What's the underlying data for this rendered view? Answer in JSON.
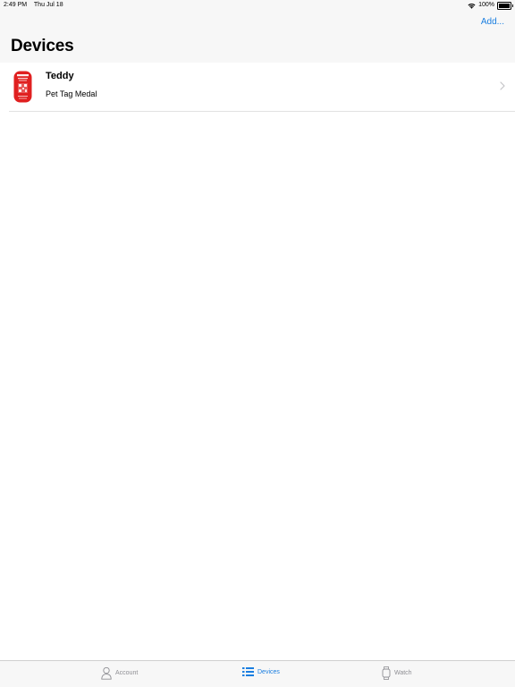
{
  "status_bar": {
    "time": "2:49 PM",
    "date": "Thu Jul 18",
    "battery_percent": "100%",
    "battery_level": 1.0
  },
  "header": {
    "title": "Devices",
    "add_label": "Add..."
  },
  "devices": [
    {
      "name": "Teddy",
      "type": "Pet Tag Medal",
      "icon": "pet-tag-thumbnail",
      "thumb_color": "#e02020"
    }
  ],
  "tabs": [
    {
      "label": "Account",
      "icon": "person-icon",
      "active": false
    },
    {
      "label": "Devices",
      "icon": "list-icon",
      "active": true
    },
    {
      "label": "Watch",
      "icon": "watch-icon",
      "active": false
    }
  ],
  "colors": {
    "accent": "#1a7ee0",
    "inactive": "#8e8e93",
    "bar_background": "#f7f7f7"
  }
}
